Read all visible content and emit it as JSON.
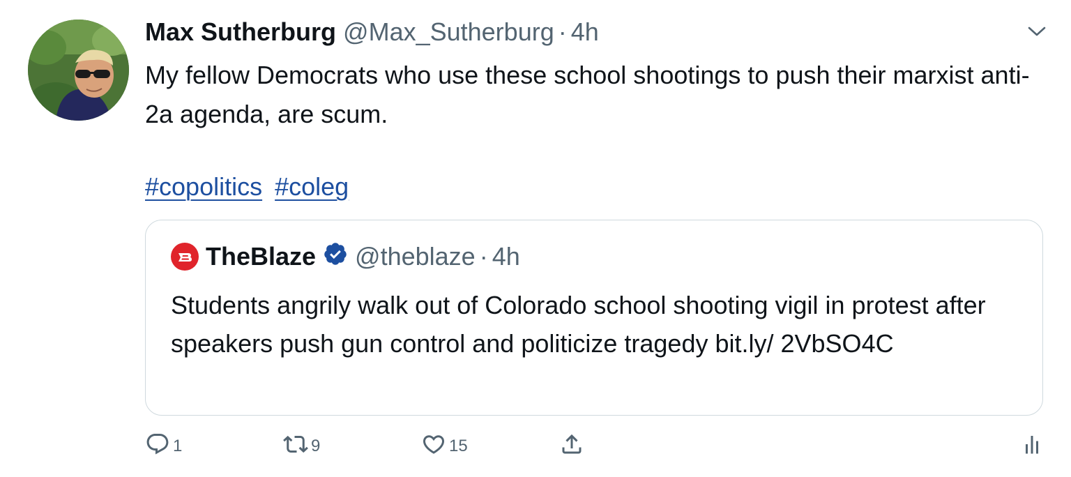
{
  "tweet": {
    "author_name": "Max Sutherburg",
    "author_handle": "@Max_Sutherburg",
    "separator": "·",
    "time": "4h",
    "text": "My fellow Democrats who use these school shootings to push their marxist anti-2a agenda, are scum.",
    "hashtags": [
      "#copolitics",
      "#coleg"
    ]
  },
  "quote": {
    "author_name": "TheBlaze",
    "author_handle": "@theblaze",
    "separator": "·",
    "time": "4h",
    "text": "Students angrily walk out of Colorado school shooting vigil in protest after speakers push gun control and politicize tragedy bit.ly/ 2VbSO4C",
    "logo_letter": "B",
    "verified": true
  },
  "actions": {
    "reply_count": "1",
    "retweet_count": "9",
    "like_count": "15"
  },
  "icons": {
    "chevron": "chevron-down-icon",
    "reply": "reply-icon",
    "retweet": "retweet-icon",
    "like": "heart-icon",
    "share": "share-icon",
    "analytics": "analytics-icon",
    "verified": "verified-badge-icon"
  },
  "colors": {
    "text": "#0f1419",
    "secondary": "#536471",
    "link": "#1d4fa0",
    "verified": "#1d4fa0",
    "blaze_red": "#e0242b",
    "border": "#cfd9de"
  }
}
